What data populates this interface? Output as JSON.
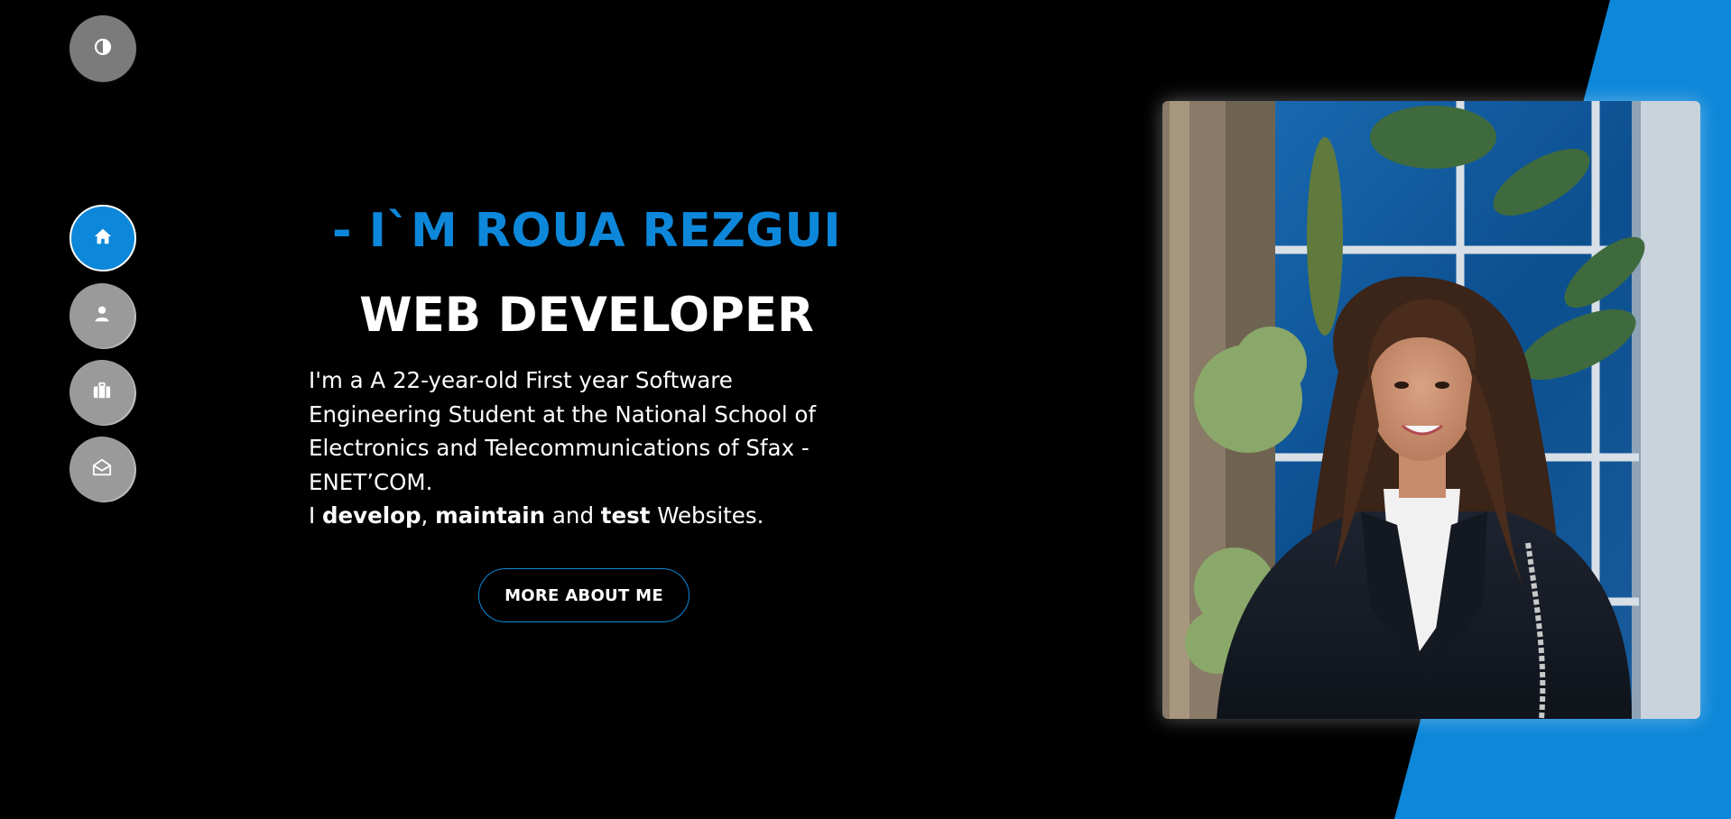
{
  "colors": {
    "accent": "#0d87d9",
    "background": "#000000",
    "text": "#ffffff",
    "nav_inactive": "#9a9a9a",
    "toggle": "#7b7b7b"
  },
  "theme_toggle": {
    "icon": "contrast-icon"
  },
  "nav": {
    "items": [
      {
        "icon": "home-icon",
        "active": true
      },
      {
        "icon": "user-icon",
        "active": false
      },
      {
        "icon": "briefcase-icon",
        "active": false
      },
      {
        "icon": "envelope-open-icon",
        "active": false
      }
    ]
  },
  "hero": {
    "name": "- I`M ROUA REZGUI",
    "role": "WEB DEVELOPER",
    "description": "I'm a A 22-year-old First year Software Engineering Student at the National School of Electronics and Telecommunications of Sfax - ENET’COM.",
    "tagline": {
      "prefix": "I ",
      "word1": "develop",
      "sep1": ", ",
      "word2": "maintain",
      "sep2": " and ",
      "word3": "test",
      "suffix": " Websites."
    },
    "cta_label": "MORE ABOUT ME"
  },
  "portrait": {
    "subject": "profile-photo"
  }
}
